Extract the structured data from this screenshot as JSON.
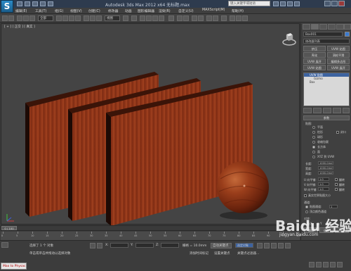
{
  "window": {
    "title": "Autodesk 3ds Max  2012 x64     无标题.max",
    "search_placeholder": "键入关键字或短语"
  },
  "menu": [
    "编辑(E)",
    "工具(T)",
    "组(G)",
    "视图(V)",
    "创建(C)",
    "修改器",
    "动画",
    "图形编辑器",
    "渲染(R)",
    "自定义(U)",
    "MAXScript(M)",
    "帮助(H)"
  ],
  "toolbar": {
    "selection_filter": "全部",
    "view_dropdown": "视图"
  },
  "viewport": {
    "label": "[ + ] [ 正交 ] [ 真实 ]"
  },
  "command_panel": {
    "object_name": "Box001",
    "modifier_list": "修改器列表",
    "buttons_row1": [
      "挤压",
      "UVW 贴图"
    ],
    "buttons_row2": [
      "壳化",
      "涡轮平滑"
    ],
    "buttons_row3": [
      "UVW 展开",
      "编辑多边形"
    ],
    "buttons_row4": [
      "UVW 贴图",
      "UVW 展开"
    ],
    "stack": [
      "UVW 贴图",
      "Gizmo",
      "Box"
    ],
    "params_header": "参数",
    "mapping_label": "贴图:",
    "mapping_options": [
      "平面",
      "柱形",
      "球形",
      "收缩包裹",
      "长方体",
      "面",
      "XYZ 到 UVW"
    ],
    "mapping_selected": 4,
    "cap_label": "封口",
    "length_label": "长度:",
    "length_value": "1000.0mm",
    "width_label": "宽度:",
    "width_value": "1000.0mm",
    "height_label": "高度:",
    "height_value": "1000.0mm",
    "utile_label": "U 向平铺:",
    "utile_value": "1.0",
    "vtile_label": "V 向平铺:",
    "vtile_value": "1.0",
    "wtile_label": "W 向平铺:",
    "wtile_value": "1.0",
    "flip_label": "翻转",
    "realworld_label": "真实世界贴图大小",
    "channel_header": "通道:",
    "channel_options": [
      "贴图通道:",
      "顶点颜色通道"
    ],
    "channel_value": "1",
    "align_header": "对齐:",
    "axes": [
      "X",
      "Y",
      "Z"
    ],
    "align_buttons": [
      "操纵",
      "适配",
      "中心"
    ]
  },
  "timeline": {
    "frame": "0 / 100",
    "ticks": [
      "0",
      "5",
      "10",
      "15",
      "20",
      "25",
      "30",
      "35",
      "40",
      "45",
      "50",
      "55",
      "60",
      "65",
      "70",
      "75",
      "80",
      "85",
      "90",
      "95",
      "100"
    ]
  },
  "status": {
    "selected": "选择了 1 个 对象",
    "prompt": "单击或单击并拖动以选择对象",
    "maxscript": "Max to Physac",
    "x_label": "X:",
    "y_label": "Y:",
    "z_label": "Z:",
    "grid": "栅格 = 10.0mm",
    "autokey": "自动关键点",
    "selected_set": "选定对象",
    "set_key": "设置关键点",
    "key_filters": "关键点过滤器...",
    "add_time_tag": "添加时间标记"
  },
  "watermark": {
    "brand": "Baidu 经验",
    "url": "jingyan.baidu.com"
  },
  "colors": {
    "wood": "#8e3418",
    "wood_dark": "#5c1d0c",
    "viewport_bg": "#444444",
    "active_button": "#3d63a0"
  }
}
